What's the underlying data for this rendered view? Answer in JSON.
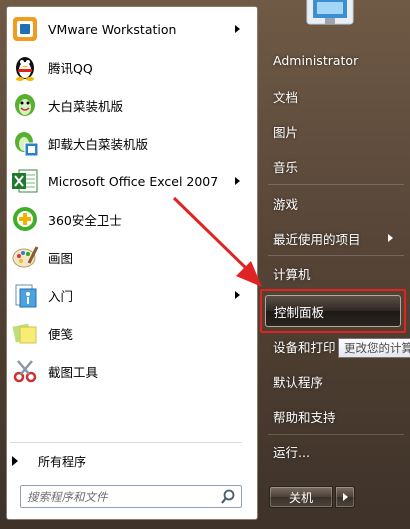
{
  "programs": [
    {
      "label": "VMware Workstation",
      "icon": "vmware-icon",
      "has_submenu": true
    },
    {
      "label": "腾讯QQ",
      "icon": "qq-penguin-icon",
      "has_submenu": false
    },
    {
      "label": "大白菜装机版",
      "icon": "cabbage-icon",
      "has_submenu": false
    },
    {
      "label": "卸载大白菜装机版",
      "icon": "uninstall-cabbage-icon",
      "has_submenu": false
    },
    {
      "label": "Microsoft Office Excel 2007",
      "icon": "excel-icon",
      "has_submenu": true
    },
    {
      "label": "360安全卫士",
      "icon": "360-safe-icon",
      "has_submenu": false
    },
    {
      "label": "画图",
      "icon": "paint-icon",
      "has_submenu": false
    },
    {
      "label": "入门",
      "icon": "getting-started-icon",
      "has_submenu": true
    },
    {
      "label": "便笺",
      "icon": "sticky-notes-icon",
      "has_submenu": false
    },
    {
      "label": "截图工具",
      "icon": "snipping-tool-icon",
      "has_submenu": false
    }
  ],
  "all_programs": "所有程序",
  "search": {
    "placeholder": "搜索程序和文件"
  },
  "right": {
    "user": "Administrator",
    "documents": "文档",
    "pictures": "图片",
    "music": "音乐",
    "games": "游戏",
    "recent": "最近使用的项目",
    "computer": "计算机",
    "control_panel": "控制面板",
    "devices": "设备和打印",
    "default_programs": "默认程序",
    "help": "帮助和支持",
    "run": "运行..."
  },
  "tooltip": "更改您的计算",
  "shutdown": "关机",
  "colors": {
    "highlight_box": "#e02323",
    "annotation_arrow": "#e02323"
  }
}
